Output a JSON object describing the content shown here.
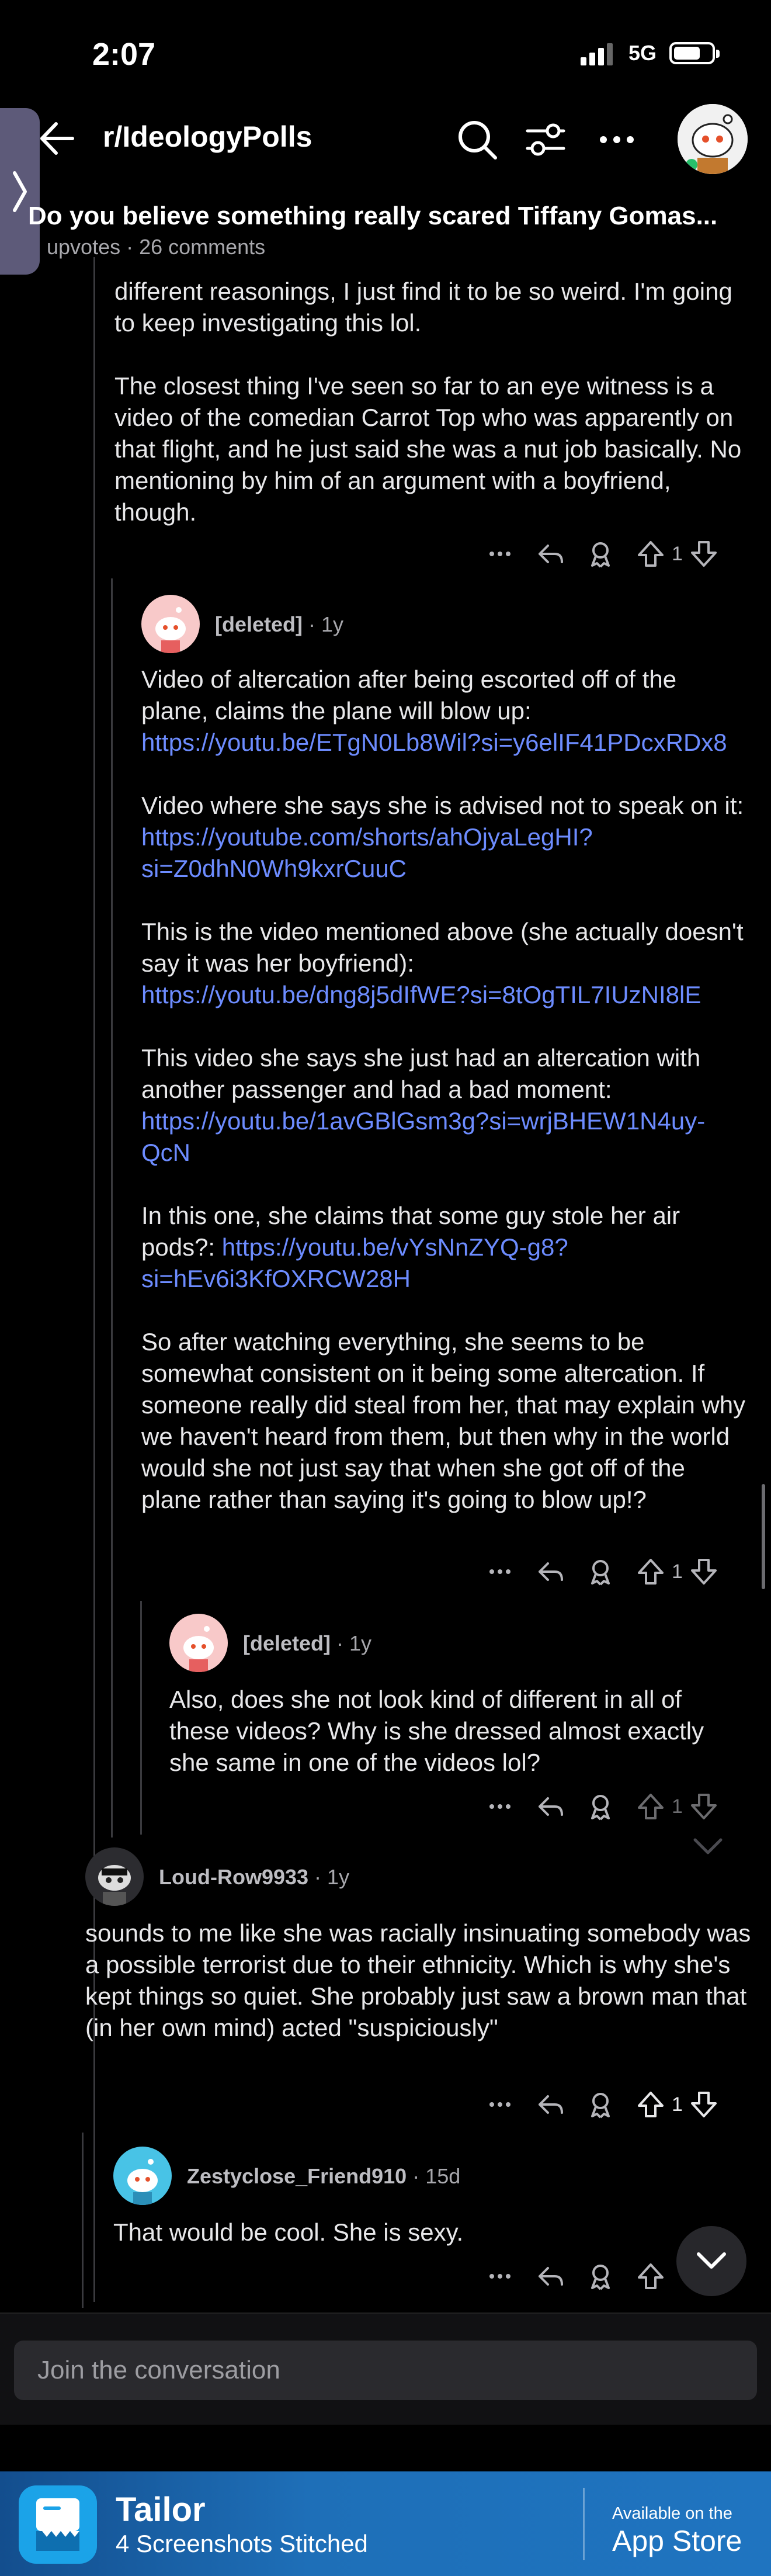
{
  "status": {
    "time": "2:07",
    "network": "5G"
  },
  "header": {
    "subreddit": "r/IdeologyPolls",
    "post_title": "Do you believe something really scared Tiffany Gomas...",
    "post_meta": "upvotes · 26 comments"
  },
  "comments": [
    {
      "paragraphs": [
        "different reasonings, I just find it to be so weird. I'm going to keep investigating this lol.",
        "The closest thing I've seen so far to an eye witness is a video of the comedian Carrot Top who was apparently on that flight, and he just said she was a nut job basically. No mentioning by him of an argument with a boyfriend, though."
      ],
      "votes": "1"
    },
    {
      "user": "[deleted]",
      "age": "1y",
      "p1_text": "Video of altercation after being escorted off of the plane, claims the plane will blow up: ",
      "p1_link": "https://youtu.be/ETgN0Lb8Wil?si=y6elIF41PDcxRDx8",
      "p2_text": "Video where she says she is advised not to speak on it: ",
      "p2_link": "https://youtube.com/shorts/ahOjyaLegHI?si=Z0dhN0Wh9kxrCuuC",
      "p3_text": "This is the video mentioned above (she actually doesn't say it was her boyfriend): ",
      "p3_link": "https://youtu.be/dng8j5dIfWE?si=8tOgTIL7IUzNI8lE",
      "p4_text": "This video she says she just had an altercation with another passenger and had a bad moment: ",
      "p4_link": "https://youtu.be/1avGBlGsm3g?si=wrjBHEW1N4uy-QcN",
      "p5_text": "In this one, she claims that some guy stole her air pods?: ",
      "p5_link": "https://youtu.be/vYsNnZYQ-g8?si=hEv6i3KfOXRCW28H",
      "p6_text": "So after watching everything, she seems to be somewhat consistent on it being some altercation. If someone really did steal from her, that may explain why we haven't heard from them, but then why in the world would she not just say that when she got off of the plane rather than saying it's going to blow up!?",
      "votes": "1"
    },
    {
      "user": "[deleted]",
      "age": "1y",
      "text": "Also, does she not look kind of different in all of these videos? Why is she dressed almost exactly she same in one of the videos lol?",
      "votes": "1"
    },
    {
      "user": "Loud-Row9933",
      "age": "1y",
      "text": "sounds to me like she was racially insinuating somebody was a possible terrorist due to their ethnicity. Which is why she's kept things so quiet. She probably just saw a brown man that (in her own mind) acted \"suspiciously\"",
      "votes": "1"
    },
    {
      "user": "Zestyclose_Friend910",
      "age": "15d",
      "text": "That would be cool. She is sexy."
    }
  ],
  "composer": {
    "placeholder": "Join the conversation"
  },
  "banner": {
    "app_name": "Tailor",
    "subtitle": "4 Screenshots Stitched",
    "available": "Available on the",
    "store": "App Store"
  },
  "icons": [
    "back-arrow-icon",
    "search-icon",
    "filter-icon",
    "more-icon",
    "reply-icon",
    "award-icon",
    "upvote-icon",
    "downvote-icon",
    "chevron-down-icon"
  ]
}
